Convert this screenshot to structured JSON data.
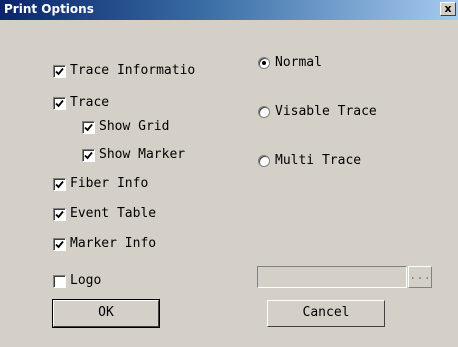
{
  "window": {
    "title": "Print Options",
    "close_glyph": "x"
  },
  "checkboxes": {
    "trace_information": {
      "label": "Trace Informatio",
      "checked": true
    },
    "trace": {
      "label": "Trace",
      "checked": true
    },
    "show_grid": {
      "label": "Show Grid",
      "checked": true
    },
    "show_marker": {
      "label": "Show Marker",
      "checked": true
    },
    "fiber_info": {
      "label": "Fiber Info",
      "checked": true
    },
    "event_table": {
      "label": "Event Table",
      "checked": true
    },
    "marker_info": {
      "label": "Marker Info",
      "checked": true
    },
    "logo": {
      "label": "Logo",
      "checked": false
    }
  },
  "radios": {
    "selected": "normal",
    "normal": {
      "label": "Normal"
    },
    "visable_trace": {
      "label": "Visable Trace"
    },
    "multi_trace": {
      "label": "Multi Trace"
    }
  },
  "logo_path": {
    "value": "",
    "browse_label": "..."
  },
  "buttons": {
    "ok": "OK",
    "cancel": "Cancel"
  }
}
